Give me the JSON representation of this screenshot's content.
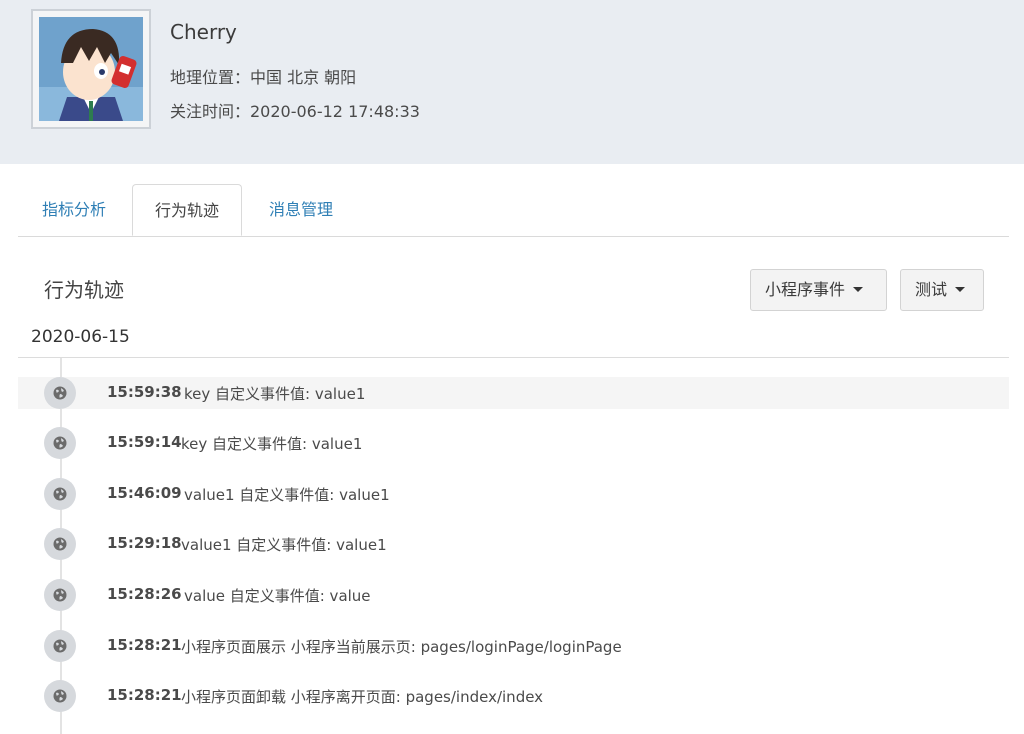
{
  "profile": {
    "name": "Cherry",
    "location": "地理位置：中国 北京 朝阳",
    "follow_time": "关注时间：2020-06-12 17:48:33"
  },
  "tabs": [
    {
      "label": "指标分析",
      "active": false
    },
    {
      "label": "行为轨迹",
      "active": true
    },
    {
      "label": "消息管理",
      "active": false
    }
  ],
  "section": {
    "title": "行为轨迹",
    "filter_event": "小程序事件",
    "filter_env": "测试"
  },
  "timeline": {
    "date": "2020-06-15",
    "events": [
      {
        "time": "15:59:38",
        "desc": "key 自定义事件值: value1",
        "icon": "globe-icon"
      },
      {
        "time": "15:59:14",
        "desc": "key 自定义事件值: value1",
        "icon": "globe-icon"
      },
      {
        "time": "15:46:09",
        "desc": "value1 自定义事件值: value1",
        "icon": "globe-icon"
      },
      {
        "time": "15:29:18",
        "desc": "value1 自定义事件值: value1",
        "icon": "globe-icon"
      },
      {
        "time": "15:28:26",
        "desc": "value 自定义事件值: value",
        "icon": "globe-icon"
      },
      {
        "time": "15:28:21",
        "desc": "小程序页面展示 小程序当前展示页: pages/loginPage/loginPage",
        "icon": "globe-icon"
      },
      {
        "time": "15:28:21",
        "desc": "小程序页面卸载 小程序离开页面: pages/index/index",
        "icon": "globe-icon"
      }
    ]
  }
}
